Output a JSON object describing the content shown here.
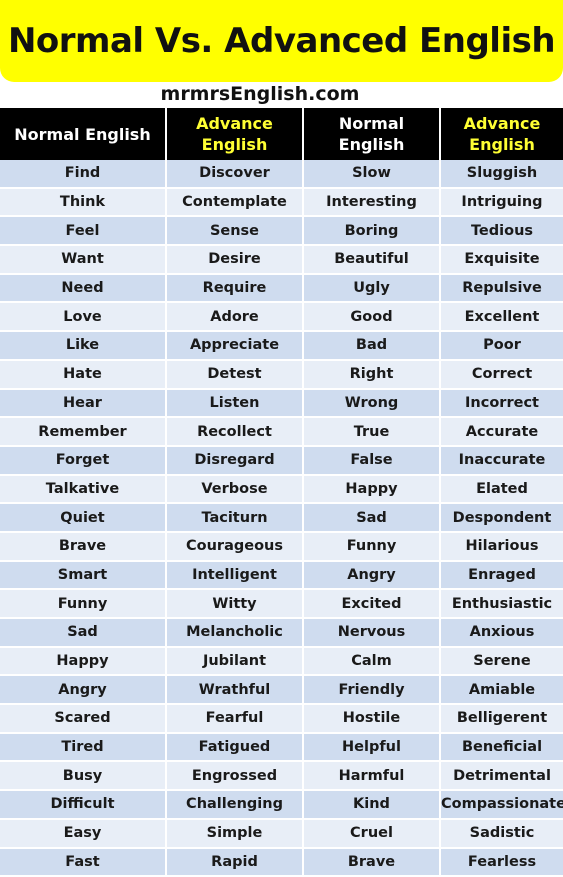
{
  "banner": {
    "title": "Normal Vs. Advanced English",
    "color": "#ffff00"
  },
  "site": "mrmrsEnglish.com",
  "table": {
    "headers": [
      "Normal English",
      "Advance English",
      "Normal English",
      "Advance English"
    ],
    "colors": {
      "header_bg": "#000000",
      "normal_header_text": "#ffffff",
      "advance_header_text": "#ffff33",
      "row_odd": "#cfdcef",
      "row_even": "#e8eef7"
    },
    "rows": [
      [
        "Find",
        "Discover",
        "Slow",
        "Sluggish"
      ],
      [
        "Think",
        "Contemplate",
        "Interesting",
        "Intriguing"
      ],
      [
        "Feel",
        "Sense",
        "Boring",
        "Tedious"
      ],
      [
        "Want",
        "Desire",
        "Beautiful",
        "Exquisite"
      ],
      [
        "Need",
        "Require",
        "Ugly",
        "Repulsive"
      ],
      [
        "Love",
        "Adore",
        "Good",
        "Excellent"
      ],
      [
        "Like",
        "Appreciate",
        "Bad",
        "Poor"
      ],
      [
        "Hate",
        "Detest",
        "Right",
        "Correct"
      ],
      [
        "Hear",
        "Listen",
        "Wrong",
        "Incorrect"
      ],
      [
        "Remember",
        "Recollect",
        "True",
        "Accurate"
      ],
      [
        "Forget",
        "Disregard",
        "False",
        "Inaccurate"
      ],
      [
        "Talkative",
        "Verbose",
        "Happy",
        "Elated"
      ],
      [
        "Quiet",
        "Taciturn",
        "Sad",
        "Despondent"
      ],
      [
        "Brave",
        "Courageous",
        "Funny",
        "Hilarious"
      ],
      [
        "Smart",
        "Intelligent",
        "Angry",
        "Enraged"
      ],
      [
        "Funny",
        "Witty",
        "Excited",
        "Enthusiastic"
      ],
      [
        "Sad",
        "Melancholic",
        "Nervous",
        "Anxious"
      ],
      [
        "Happy",
        "Jubilant",
        "Calm",
        "Serene"
      ],
      [
        "Angry",
        "Wrathful",
        "Friendly",
        "Amiable"
      ],
      [
        "Scared",
        "Fearful",
        "Hostile",
        "Belligerent"
      ],
      [
        "Tired",
        "Fatigued",
        "Helpful",
        "Beneficial"
      ],
      [
        "Busy",
        "Engrossed",
        "Harmful",
        "Detrimental"
      ],
      [
        "Difficult",
        "Challenging",
        "Kind",
        "Compassionate"
      ],
      [
        "Easy",
        "Simple",
        "Cruel",
        "Sadistic"
      ],
      [
        "Fast",
        "Rapid",
        "Brave",
        "Fearless"
      ]
    ]
  }
}
